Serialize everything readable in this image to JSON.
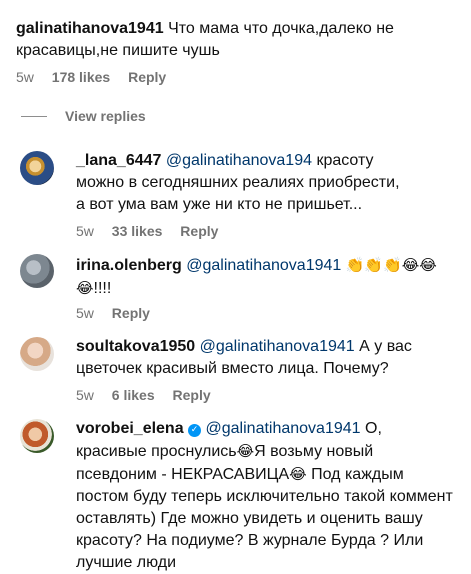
{
  "comments": [
    {
      "user": "galinatihanova1941",
      "text": "Что мама что дочка,далеко не красавицы,не пишите чушь",
      "time": "5w",
      "likes": "178 likes",
      "reply": "Reply"
    },
    {
      "user": "_lana_6447",
      "mention": "@galinatihanova194",
      "text": "красоту можно в сегодняшних реалиях приобрести, а вот ума вам уже ни кто не пришьет...",
      "time": "5w",
      "likes": "33 likes",
      "reply": "Reply"
    },
    {
      "user": "irina.olenberg",
      "mention": "@galinatihanova1941",
      "emojis": "👏👏👏😂😂",
      "emojis2": "😂",
      "text": "!!!!",
      "time": "5w",
      "reply": "Reply"
    },
    {
      "user": "soultakova1950",
      "mention": "@galinatihanova1941",
      "text": "А у вас цветочек красивый вместо лица. Почему?",
      "time": "5w",
      "likes": "6 likes",
      "reply": "Reply"
    },
    {
      "user": "vorobei_elena",
      "verified": "✓",
      "mention": "@galinatihanova1941",
      "text_a": "О, красивые проснулись",
      "emoji_a": "😂",
      "text_b": "Я возьму новый псевдоним - НЕКРАСАВИЦА",
      "emoji_b": "😂",
      "text_c": " Под каждым постом буду теперь исключительно такой коммент оставлять) Где можно увидеть и оценить вашу красоту? На подиуме? В журнале Бурда ? Или лучшие люди"
    }
  ],
  "view_replies": "View replies"
}
